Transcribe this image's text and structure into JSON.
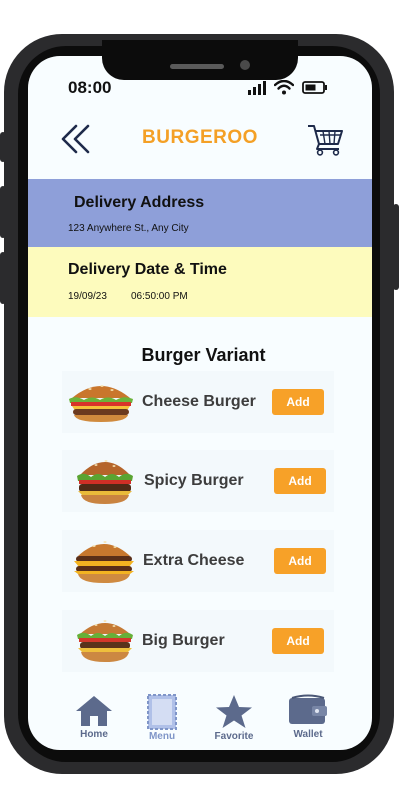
{
  "status_bar": {
    "time": "08:00"
  },
  "header": {
    "title": "BURGEROO",
    "back_icon": "double-chevron-left-icon",
    "cart_icon": "shopping-cart-icon"
  },
  "delivery_address": {
    "label": "Delivery Address",
    "value": "123 Anywhere St., Any City",
    "background": "#8e9fd9"
  },
  "delivery_datetime": {
    "label": "Delivery Date & Time",
    "date": "19/09/23",
    "time": "06:50:00 PM",
    "background": "#fdfbbd"
  },
  "section": {
    "title": "Burger Variant"
  },
  "items": [
    {
      "name": "Cheese Burger",
      "button": "Add"
    },
    {
      "name": "Spicy Burger",
      "button": "Add"
    },
    {
      "name": "Extra Cheese",
      "button": "Add"
    },
    {
      "name": "Big Burger",
      "button": "Add"
    }
  ],
  "nav": [
    {
      "label": "Home",
      "icon": "home-icon",
      "active": false
    },
    {
      "label": "Menu",
      "icon": "menu-icon",
      "active": true
    },
    {
      "label": "Favorite",
      "icon": "star-icon",
      "active": false
    },
    {
      "label": "Wallet",
      "icon": "wallet-icon",
      "active": false
    }
  ],
  "colors": {
    "accent": "#f4a026",
    "button": "#f7a128",
    "nav_icon": "#5c6a8c",
    "nav_active": "#b0c0e8"
  }
}
